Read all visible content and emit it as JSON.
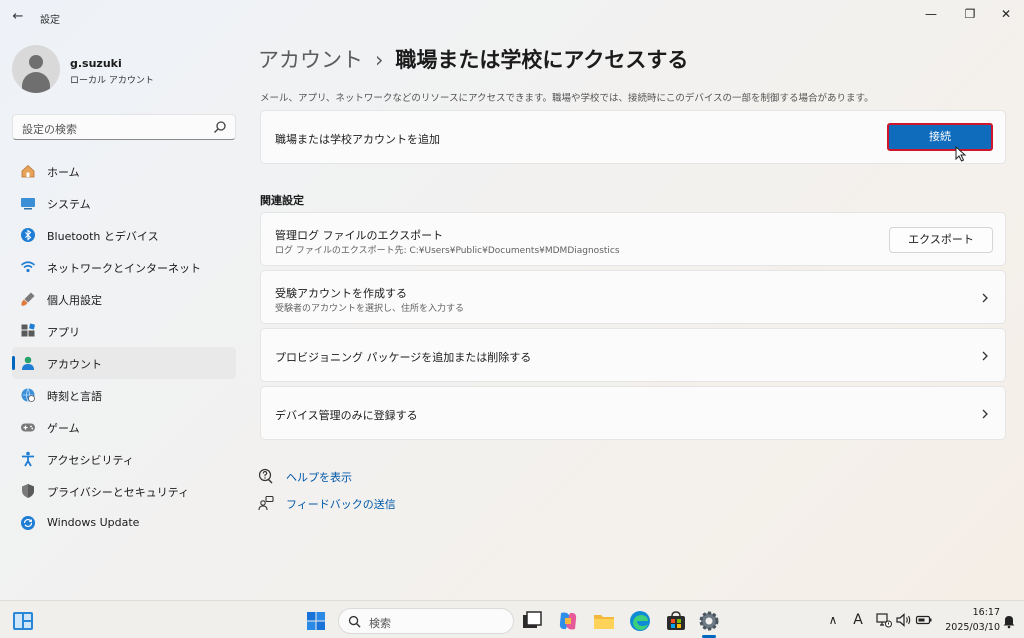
{
  "window": {
    "title": "設定",
    "back_glyph": "←",
    "minimize_glyph": "—",
    "maximize_glyph": "❐",
    "close_glyph": "✕"
  },
  "profile": {
    "username": "g.suzuki",
    "account_type": "ローカル アカウント"
  },
  "search": {
    "placeholder": "設定の検索"
  },
  "nav": {
    "items": [
      {
        "label": "ホーム",
        "icon": "home-icon"
      },
      {
        "label": "システム",
        "icon": "system-icon"
      },
      {
        "label": "Bluetooth とデバイス",
        "icon": "bluetooth-icon"
      },
      {
        "label": "ネットワークとインターネット",
        "icon": "wifi-icon"
      },
      {
        "label": "個人用設定",
        "icon": "brush-icon"
      },
      {
        "label": "アプリ",
        "icon": "apps-icon"
      },
      {
        "label": "アカウント",
        "icon": "account-icon",
        "active": true
      },
      {
        "label": "時刻と言語",
        "icon": "globe-clock-icon"
      },
      {
        "label": "ゲーム",
        "icon": "gamepad-icon"
      },
      {
        "label": "アクセシビリティ",
        "icon": "accessibility-icon"
      },
      {
        "label": "プライバシーとセキュリティ",
        "icon": "shield-icon"
      },
      {
        "label": "Windows Update",
        "icon": "update-icon"
      }
    ]
  },
  "main": {
    "breadcrumb": {
      "parent": "アカウント",
      "separator": "›",
      "current": "職場または学校にアクセスする"
    },
    "description": "メール、アプリ、ネットワークなどのリソースにアクセスできます。職場や学校では、接続時にこのデバイスの一部を制御する場合があります。",
    "add_account": {
      "label": "職場または学校アカウントを追加",
      "button": "接続"
    },
    "related_title": "関連設定",
    "export_logs": {
      "title": "管理ログ ファイルのエクスポート",
      "subtitle": "ログ ファイルのエクスポート先: C:¥Users¥Public¥Documents¥MDMDiagnostics",
      "button": "エクスポート"
    },
    "test_account": {
      "title": "受験アカウントを作成する",
      "subtitle": "受験者のアカウントを選択し、住所を入力する"
    },
    "provisioning": {
      "title": "プロビジョニング パッケージを追加または削除する"
    },
    "enroll": {
      "title": "デバイス管理のみに登録する"
    },
    "help_link": "ヘルプを表示",
    "feedback_link": "フィードバックの送信"
  },
  "taskbar": {
    "search_placeholder": "検索",
    "time": "16:17",
    "date": "2025/03/10",
    "ime_glyph": "A",
    "overflow_glyph": "∧",
    "accent": "#0067c0"
  },
  "colors": {
    "primary_button": "#0f6cbd",
    "highlight_border": "#d0162b"
  }
}
